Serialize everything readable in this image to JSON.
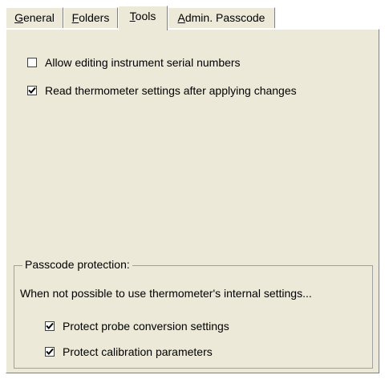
{
  "tabs": [
    {
      "label": "General",
      "underline": "G"
    },
    {
      "label": "Folders",
      "underline": "F"
    },
    {
      "label": "Tools",
      "underline": "T"
    },
    {
      "label": "Admin. Passcode",
      "underline": "A"
    }
  ],
  "active_tab": "Tools",
  "options": [
    {
      "label": "Allow editing instrument serial numbers",
      "checked": false
    },
    {
      "label": "Read thermometer settings after applying changes",
      "checked": true
    }
  ],
  "passcode_group": {
    "title": "Passcode protection:",
    "description": "When not possible to use thermometer's internal settings...",
    "options": [
      {
        "label": "Protect probe conversion settings",
        "checked": true
      },
      {
        "label": "Protect calibration parameters",
        "checked": true
      }
    ]
  }
}
